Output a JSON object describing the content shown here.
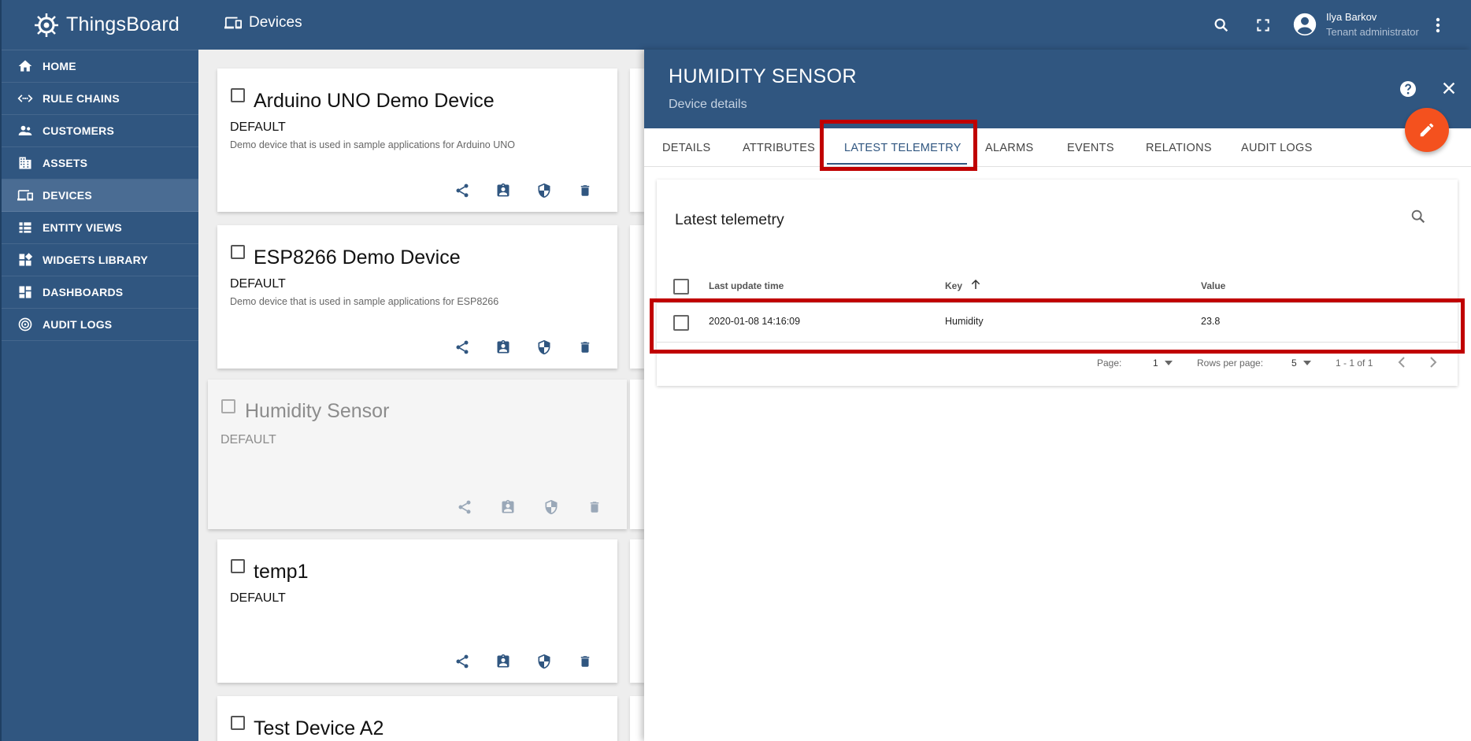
{
  "app": {
    "name": "ThingsBoard"
  },
  "sidebar": {
    "items": [
      {
        "label": "HOME",
        "icon": "home-icon"
      },
      {
        "label": "RULE CHAINS",
        "icon": "rule-chains-icon"
      },
      {
        "label": "CUSTOMERS",
        "icon": "customers-icon"
      },
      {
        "label": "ASSETS",
        "icon": "assets-icon"
      },
      {
        "label": "DEVICES",
        "icon": "devices-icon",
        "active": true
      },
      {
        "label": "ENTITY VIEWS",
        "icon": "entity-views-icon"
      },
      {
        "label": "WIDGETS LIBRARY",
        "icon": "widgets-library-icon"
      },
      {
        "label": "DASHBOARDS",
        "icon": "dashboards-icon"
      },
      {
        "label": "AUDIT LOGS",
        "icon": "audit-logs-icon"
      }
    ]
  },
  "topbar": {
    "breadcrumb": "Devices",
    "user": {
      "name": "Ilya Barkov",
      "role": "Tenant administrator"
    }
  },
  "devices": [
    {
      "name": "Arduino UNO Demo Device",
      "type": "DEFAULT",
      "description": "Demo device that is used in sample applications for Arduino UNO"
    },
    {
      "name": "ESP8266 Demo Device",
      "type": "DEFAULT",
      "description": "Demo device that is used in sample applications for ESP8266"
    },
    {
      "name": "Humidity Sensor",
      "type": "DEFAULT",
      "description": ""
    },
    {
      "name": "temp1",
      "type": "DEFAULT",
      "description": ""
    },
    {
      "name": "Test Device A2",
      "type": "",
      "description": ""
    }
  ],
  "panel": {
    "title": "HUMIDITY SENSOR",
    "subtitle": "Device details",
    "tabs": [
      "DETAILS",
      "ATTRIBUTES",
      "LATEST TELEMETRY",
      "ALARMS",
      "EVENTS",
      "RELATIONS",
      "AUDIT LOGS"
    ],
    "active_tab": "LATEST TELEMETRY",
    "telemetry": {
      "title": "Latest telemetry",
      "columns": {
        "time": "Last update time",
        "key": "Key",
        "value": "Value"
      },
      "rows": [
        {
          "time": "2020-01-08 14:16:09",
          "key": "Humidity",
          "value": "23.8"
        }
      ],
      "pagination": {
        "page_label": "Page:",
        "page": "1",
        "rows_per_page_label": "Rows per page:",
        "rows_per_page": "5",
        "range": "1 - 1 of 1"
      }
    }
  },
  "colors": {
    "primary": "#305680",
    "accent": "#f4511e",
    "highlight": "#c00000"
  }
}
